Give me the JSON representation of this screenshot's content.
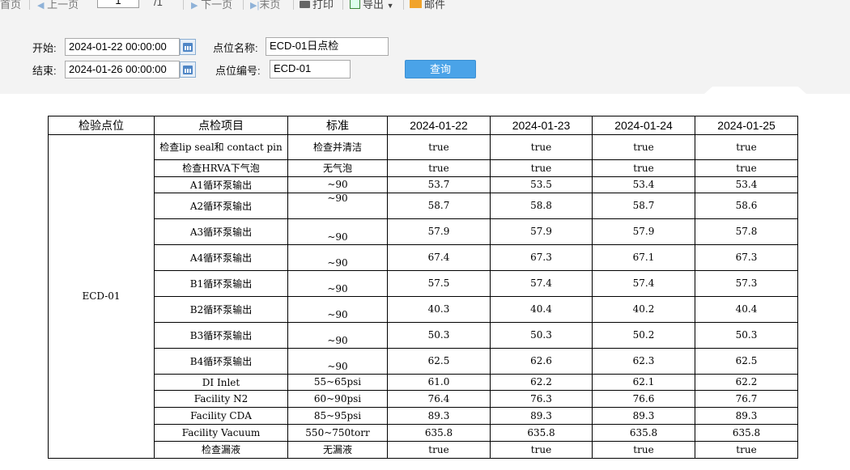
{
  "toolbar": {
    "first_page": "首页",
    "prev_page": "上一页",
    "page_value": "1",
    "page_total": "/1",
    "next_page": "下一页",
    "last_page": "末页",
    "print": "打印",
    "export": "导出",
    "mail": "邮件"
  },
  "query": {
    "start_label": "开始:",
    "start_value": "2024-01-22 00:00:00",
    "end_label": "结束:",
    "end_value": "2024-01-26 00:00:00",
    "point_name_label": "点位名称:",
    "point_name_value": "ECD-01日点检",
    "point_code_label": "点位编号:",
    "point_code_value": "ECD-01",
    "query_button": "查询",
    "accent_color": "#4aa3e8"
  },
  "report": {
    "headers": [
      "检验点位",
      "点检项目",
      "标准",
      "2024-01-22",
      "2024-01-23",
      "2024-01-24",
      "2024-01-25"
    ],
    "point": "ECD-01",
    "rows": [
      {
        "item": "检查lip seal和 contact pin",
        "standard": "检查并清洁",
        "values": [
          "true",
          "true",
          "true",
          "true"
        ]
      },
      {
        "item": "检查HRVA下气泡",
        "standard": "无气泡",
        "values": [
          "true",
          "true",
          "true",
          "true"
        ]
      },
      {
        "item": "A1循环泵输出",
        "standard": "~90",
        "values": [
          "53.7",
          "53.5",
          "53.4",
          "53.4"
        ]
      },
      {
        "item": "A2循环泵输出",
        "standard": "~90",
        "values": [
          "58.7",
          "58.8",
          "58.7",
          "58.6"
        ]
      },
      {
        "item": "A3循环泵输出",
        "standard": "~90",
        "values": [
          "57.9",
          "57.9",
          "57.9",
          "57.8"
        ]
      },
      {
        "item": "A4循环泵输出",
        "standard": "~90",
        "values": [
          "67.4",
          "67.3",
          "67.1",
          "67.3"
        ]
      },
      {
        "item": "B1循环泵输出",
        "standard": "~90",
        "values": [
          "57.5",
          "57.4",
          "57.4",
          "57.3"
        ]
      },
      {
        "item": "B2循环泵输出",
        "standard": "~90",
        "values": [
          "40.3",
          "40.4",
          "40.2",
          "40.4"
        ]
      },
      {
        "item": "B3循环泵输出",
        "standard": "~90",
        "values": [
          "50.3",
          "50.3",
          "50.2",
          "50.3"
        ]
      },
      {
        "item": "B4循环泵输出",
        "standard": "~90",
        "values": [
          "62.5",
          "62.6",
          "62.3",
          "62.5"
        ]
      },
      {
        "item": "DI Inlet",
        "standard": "55~65psi",
        "values": [
          "61.0",
          "62.2",
          "62.1",
          "62.2"
        ]
      },
      {
        "item": "Facility N2",
        "standard": "60~90psi",
        "values": [
          "76.4",
          "76.3",
          "76.6",
          "76.7"
        ]
      },
      {
        "item": "Facility CDA",
        "standard": "85~95psi",
        "values": [
          "89.3",
          "89.3",
          "89.3",
          "89.3"
        ]
      },
      {
        "item": "Facility Vacuum",
        "standard": "550~750torr",
        "values": [
          "635.8",
          "635.8",
          "635.8",
          "635.8"
        ]
      },
      {
        "item": "检查漏液",
        "standard": "无漏液",
        "values": [
          "true",
          "true",
          "true",
          "true"
        ]
      }
    ]
  }
}
